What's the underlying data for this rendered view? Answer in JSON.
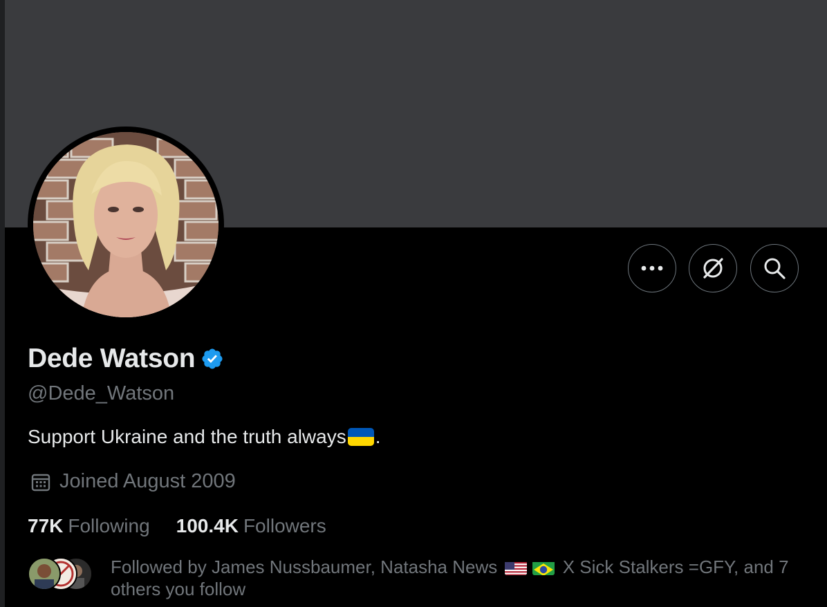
{
  "profile": {
    "display_name": "Dede Watson",
    "handle": "@Dede_Watson",
    "bio_text": "Support Ukraine and the truth always",
    "bio_end": ".",
    "bio_flag": "ukraine-flag",
    "joined": "Joined August 2009",
    "verified": true
  },
  "stats": {
    "following_count": "77K",
    "following_label": "Following",
    "followers_count": "100.4K",
    "followers_label": "Followers"
  },
  "followed_by": {
    "prefix": "Followed by James Nussbaumer, Natasha News",
    "flags": [
      "us-flag",
      "brazil-flag"
    ],
    "suffix": "X Sick Stalkers =GFY, and 7 others you follow"
  },
  "actions": {
    "more_icon": "more-icon",
    "grok_icon": "grok-icon",
    "search_icon": "search-icon"
  },
  "colors": {
    "banner": "#3a3b3e",
    "verified": "#1d9bf0",
    "muted_text": "#71767b",
    "primary_text": "#e7e9ea"
  }
}
